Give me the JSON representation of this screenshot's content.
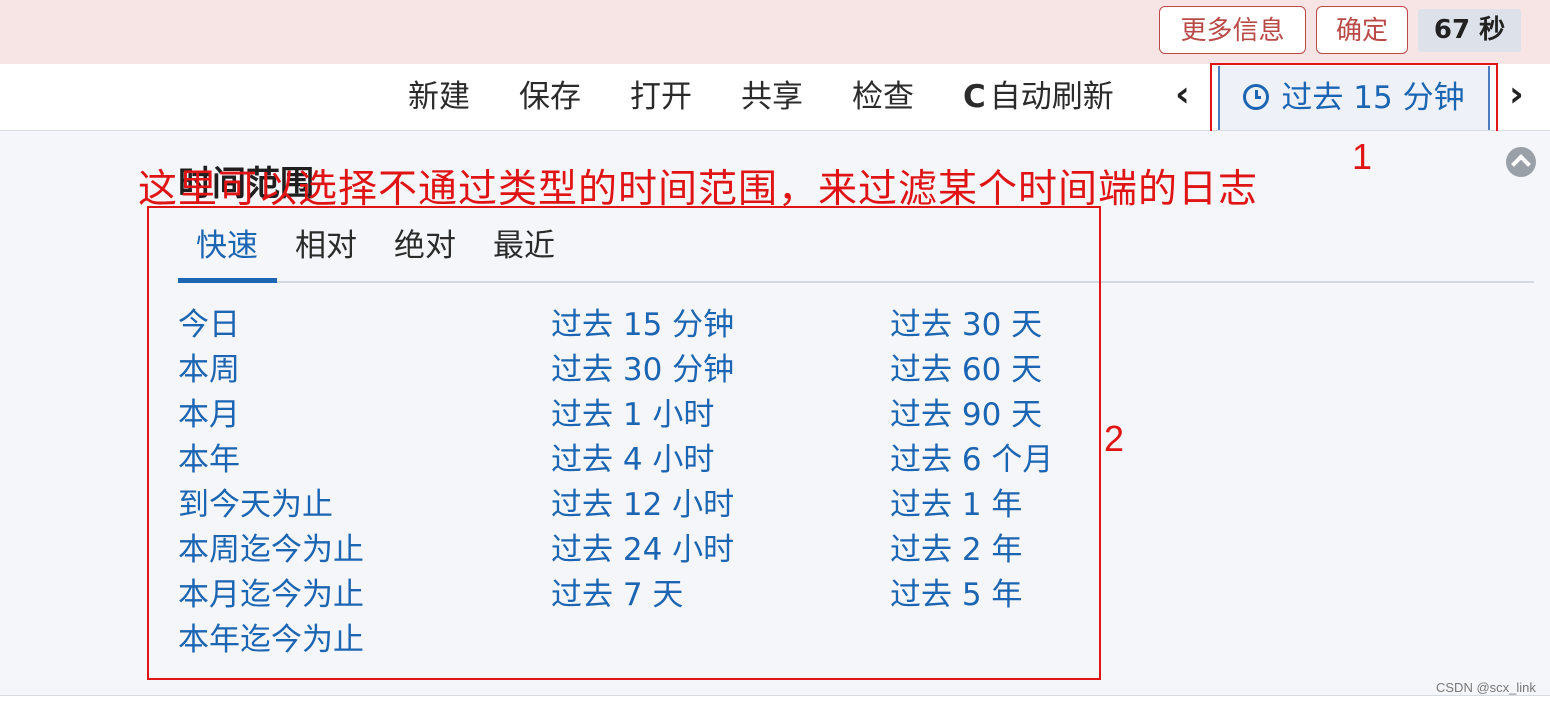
{
  "topbar": {
    "more_info": "更多信息",
    "confirm": "确定",
    "countdown": "67 秒"
  },
  "nav": {
    "new": "新建",
    "save": "保存",
    "open": "打开",
    "share": "共享",
    "inspect": "检查",
    "auto_refresh": "自动刷新",
    "refresh_icon": "C",
    "prev": "‹",
    "next": "›",
    "time_range": "过去 15 分钟"
  },
  "panel": {
    "title": "时间范围",
    "tabs": [
      "快速",
      "相对",
      "绝对",
      "最近"
    ],
    "active_tab": "快速",
    "columns": [
      [
        "今日",
        "本周",
        "本月",
        "本年",
        "到今天为止",
        "本周迄今为止",
        "本月迄今为止",
        "本年迄今为止"
      ],
      [
        "过去 15 分钟",
        "过去 30 分钟",
        "过去 1 小时",
        "过去 4 小时",
        "过去 12 小时",
        "过去 24 小时",
        "过去 7 天"
      ],
      [
        "过去 30 天",
        "过去 60 天",
        "过去 90 天",
        "过去 6 个月",
        "过去 1 年",
        "过去 2 年",
        "过去 5 年"
      ]
    ]
  },
  "annotations": {
    "text": "这里可以选择不通过类型的时间范围，来过滤某个时间端的日志",
    "label_1": "1",
    "label_2": "2"
  },
  "watermark": "CSDN @scx_link",
  "colors": {
    "accent": "#1b65b3",
    "alert_bg": "#f7e5e5",
    "alert_border": "#b94a48",
    "annotation_red": "#e01414",
    "panel_bg": "#f5f6fa"
  },
  "icons": {
    "refresh": "refresh-icon",
    "clock": "clock-icon",
    "prev": "chevron-left-icon",
    "next": "chevron-right-icon",
    "collapse": "chevron-up-circle-icon"
  }
}
